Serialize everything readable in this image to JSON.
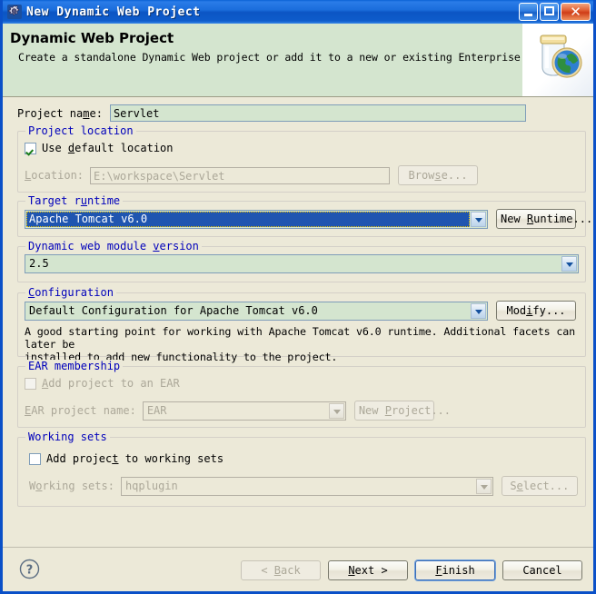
{
  "window": {
    "title": "New Dynamic Web Project",
    "icon": "gear-icon",
    "controls": {
      "minimize": "Minimize",
      "maximize": "Maximize",
      "close": "Close"
    }
  },
  "banner": {
    "title": "Dynamic Web Project",
    "description": "Create a standalone Dynamic Web project or add it to a new or existing Enterprise Application.",
    "image": "jar-globe-icon",
    "bg_color": "#d4e5cf"
  },
  "form": {
    "project_name": {
      "label": "Project name:",
      "value": "Servlet"
    },
    "project_location": {
      "group_label": "Project location",
      "use_default_label": "Use default location",
      "use_default_checked": true,
      "location_label": "Location:",
      "location_value": "E:\\workspace\\Servlet",
      "browse_label": "Browse...",
      "browse_enabled": false
    },
    "target_runtime": {
      "group_label": "Target runtime",
      "value": "Apache Tomcat v6.0",
      "selected": true,
      "new_runtime_label": "New Runtime..."
    },
    "module_version": {
      "group_label": "Dynamic web module version",
      "value": "2.5"
    },
    "configuration": {
      "group_label": "Configuration",
      "value": "Default Configuration for Apache Tomcat v6.0",
      "modify_label": "Modify...",
      "description_line1": "A good starting point for working with Apache Tomcat v6.0 runtime.  Additional facets can later be",
      "description_line2": "installed to add new functionality to the project."
    },
    "ear_membership": {
      "group_label": "EAR membership",
      "add_to_ear_label": "Add project to an EAR",
      "add_to_ear_checked": false,
      "ear_name_label": "EAR project name:",
      "ear_name_value": "EAR",
      "new_project_label": "New Project...",
      "enabled": false
    },
    "working_sets": {
      "group_label": "Working sets",
      "add_to_working_sets_label": "Add project to working sets",
      "add_to_working_sets_checked": false,
      "working_sets_label": "Working sets:",
      "working_sets_value": "hqplugin",
      "select_label": "Select...",
      "enabled": false
    }
  },
  "footer": {
    "help": "help-icon",
    "back": "< Back",
    "back_enabled": false,
    "next": "Next >",
    "finish": "Finish",
    "cancel": "Cancel",
    "default_button": "Finish"
  },
  "colors": {
    "titlebar": "#0c55c4",
    "dialog_bg": "#ece9d8",
    "field_bg": "#d4e5cf",
    "group_label": "#0000bb",
    "selection": "#1f55b0",
    "disabled_text": "#aca899"
  }
}
